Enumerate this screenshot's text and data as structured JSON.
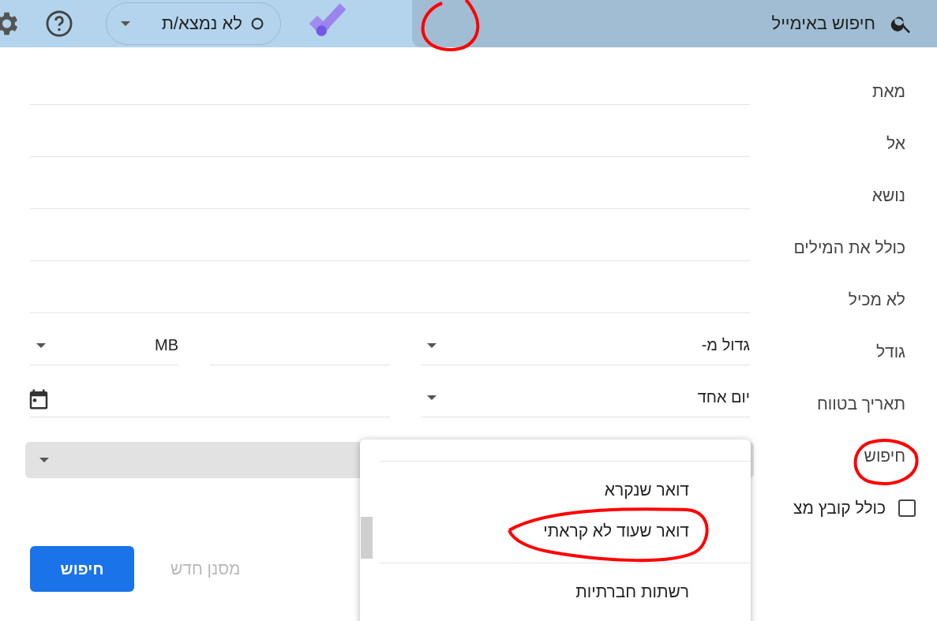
{
  "header": {
    "search_placeholder": "חיפוש באימייל",
    "status": {
      "label": "לא נמצא/ת"
    }
  },
  "form": {
    "rows": [
      {
        "kind": "text",
        "label": "מאת"
      },
      {
        "kind": "text",
        "label": "אל"
      },
      {
        "kind": "text",
        "label": "נושא"
      },
      {
        "kind": "text",
        "label": "כולל את המילים"
      },
      {
        "kind": "text",
        "label": "לא מכיל"
      },
      {
        "kind": "size",
        "label": "גודל",
        "operator": "גדול מ-",
        "unit": "MB"
      },
      {
        "kind": "date",
        "label": "תאריך בטווח",
        "range": "יום אחד"
      },
      {
        "kind": "select",
        "label": "חיפוש"
      },
      {
        "kind": "checkbox",
        "label": "כולל קובץ מצ",
        "checked": false
      }
    ]
  },
  "buttons": {
    "new_filter": "מסנן חדש",
    "search": "חיפוש"
  },
  "dropdown_menu": {
    "items": [
      {
        "label": "דואר שנקרא"
      },
      {
        "label": "דואר שעוד לא קראתי"
      },
      {
        "label": "רשתות חברתיות",
        "divider_before": true
      }
    ]
  },
  "annotations": [
    {
      "kind": "circle"
    },
    {
      "kind": "circle"
    },
    {
      "kind": "circle"
    }
  ]
}
